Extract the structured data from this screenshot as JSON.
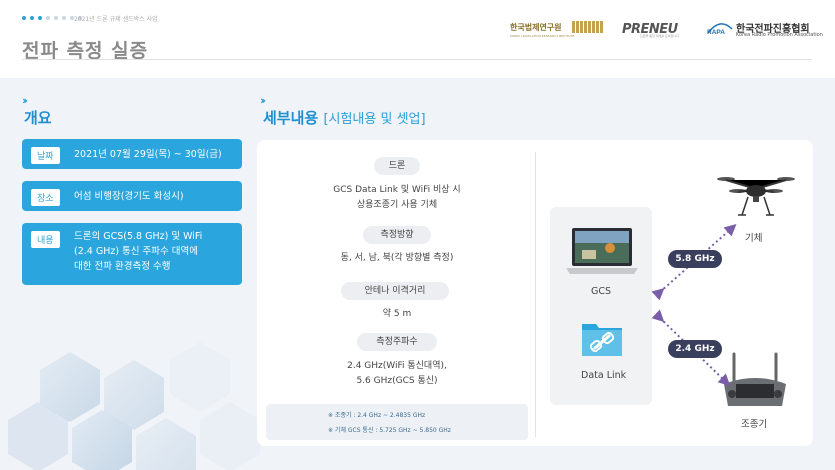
{
  "header": {
    "subtitle": "2021년 드론 규제 샌드박스 사업",
    "title": "전파 측정 실증",
    "logos": {
      "kleri_kr": "한국법제연구원",
      "kleri_en": "KOREA LEGISLATION RESEARCH INSTITUTE",
      "preneu": "PRENEU",
      "preneu_tag": "드론을 통한 미래를 준비합니다",
      "rapa_mark": "RAPA",
      "rapa_kr": "한국전파진흥협회",
      "rapa_en": "Korea Radio Promotion Association"
    }
  },
  "overview": {
    "title": "개요",
    "items": [
      {
        "tag": "날짜",
        "value": "2021년 07월 29일(목) ~ 30일(금)"
      },
      {
        "tag": "장소",
        "value": "어섬 비행장(경기도 화성시)"
      },
      {
        "tag": "내용",
        "value": [
          "드론의 GCS(5.8 GHz) 및 WiFi",
          "(2.4 GHz) 통신 주파수 대역에",
          "대한 전파 환경측정 수행"
        ]
      }
    ]
  },
  "details": {
    "title": "세부내용",
    "title_bracket": "[시험내용 및 셋업]",
    "rows": [
      {
        "pill": "드론",
        "text": [
          "GCS Data Link 및 WiFi 비상 시",
          "상용조종기 사용 기체"
        ]
      },
      {
        "pill": "측정방향",
        "text": [
          "동, 서, 남, 북(각 방향별 측정)"
        ]
      },
      {
        "pill": "안테나 이격거리",
        "text": [
          "약 5 m"
        ]
      },
      {
        "pill": "측정주파수",
        "text": [
          "2.4 GHz(WiFi 통신대역),",
          "5.6 GHz(GCS 통신)"
        ]
      }
    ],
    "notes": [
      "※ 조종기 : 2.4 GHz ~ 2.4835 GHz",
      "※ 기체 GCS 통신 : 5.725 GHz ~ 5.850 GHz"
    ]
  },
  "diagram": {
    "gcs_label": "GCS",
    "datalink_label": "Data Link",
    "drone_label": "기체",
    "controller_label": "조종기",
    "freq_top": "5.8 GHz",
    "freq_bottom": "2.4 GHz"
  },
  "colors": {
    "accent": "#2aa5dd",
    "badge": "#3b3f5e",
    "arrow": "#7a5fa8"
  }
}
